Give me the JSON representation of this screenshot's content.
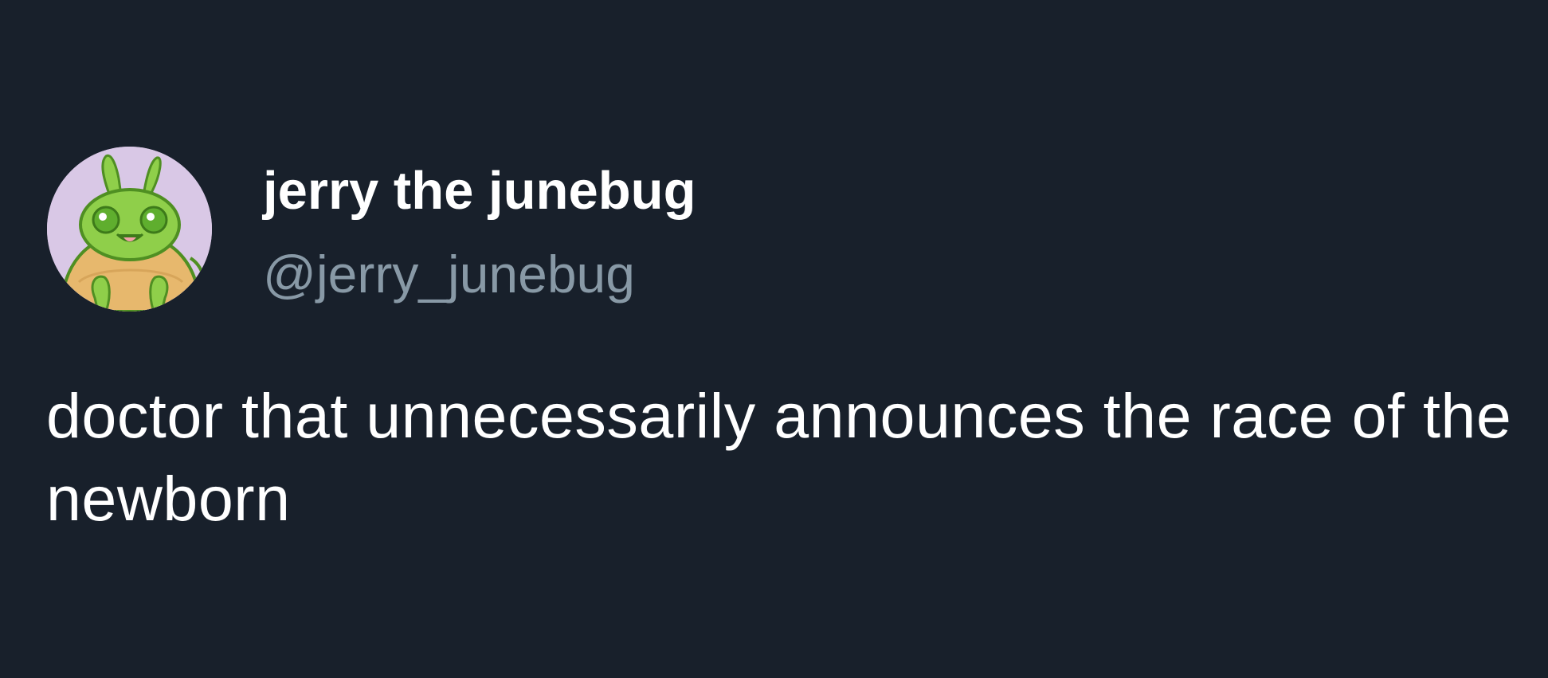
{
  "tweet": {
    "author": {
      "display_name": "jerry the junebug",
      "handle": "@jerry_junebug",
      "avatar_icon": "junebug-avatar-icon"
    },
    "text": "doctor that unnecessarily announces the race of the newborn"
  },
  "colors": {
    "background": "#18202b",
    "name_text": "#ffffff",
    "handle_text": "#8899a6",
    "body_text": "#ffffff",
    "avatar_background": "#d9c8e6"
  }
}
